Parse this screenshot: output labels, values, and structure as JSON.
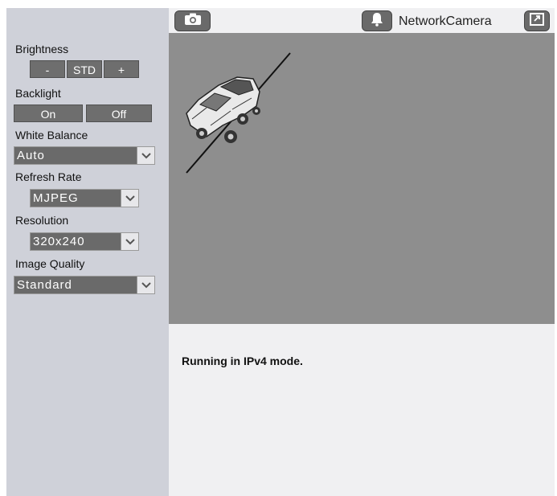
{
  "toolbar": {
    "camera_name": "NetworkCamera"
  },
  "sidebar": {
    "brightness": {
      "label": "Brightness",
      "minus": "-",
      "std": "STD",
      "plus": "+"
    },
    "backlight": {
      "label": "Backlight",
      "on": "On",
      "off": "Off"
    },
    "white_balance": {
      "label": "White Balance",
      "value": "Auto"
    },
    "refresh_rate": {
      "label": "Refresh Rate",
      "value": "MJPEG"
    },
    "resolution": {
      "label": "Resolution",
      "value": "320x240"
    },
    "image_quality": {
      "label": "Image Quality",
      "value": "Standard"
    }
  },
  "status": {
    "message": "Running in IPv4 mode."
  },
  "icons": {
    "snapshot": "camera-icon",
    "alarm": "bell-icon",
    "fullscreen": "fullscreen-icon",
    "dropdown": "chevron-down-icon"
  }
}
